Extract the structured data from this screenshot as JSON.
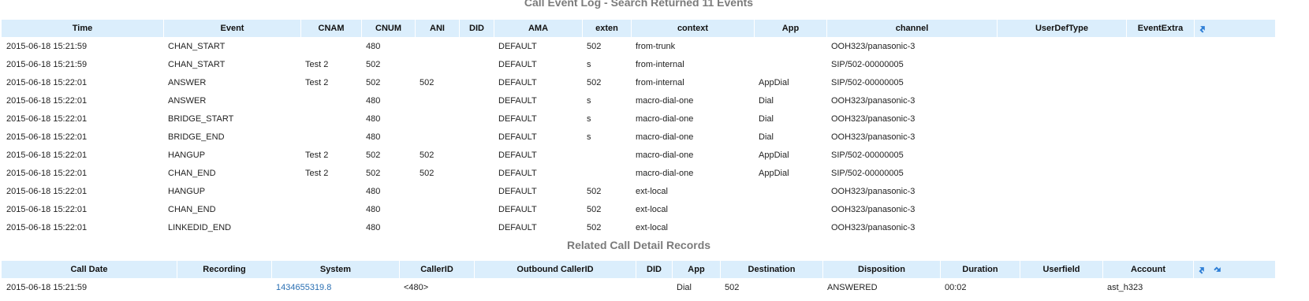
{
  "cel": {
    "title": "Call Event Log - Search Returned 11 Events",
    "columns": [
      "Time",
      "Event",
      "CNAM",
      "CNUM",
      "ANI",
      "DID",
      "AMA",
      "exten",
      "context",
      "App",
      "channel",
      "UserDefType",
      "EventExtra"
    ],
    "rows": [
      [
        "2015-06-18 15:21:59",
        "CHAN_START",
        "",
        "480",
        "",
        "",
        "DEFAULT",
        "502",
        "from-trunk",
        "",
        "OOH323/panasonic-3",
        "",
        ""
      ],
      [
        "2015-06-18 15:21:59",
        "CHAN_START",
        "Test 2",
        "502",
        "",
        "",
        "DEFAULT",
        "s",
        "from-internal",
        "",
        "SIP/502-00000005",
        "",
        ""
      ],
      [
        "2015-06-18 15:22:01",
        "ANSWER",
        "Test 2",
        "502",
        "502",
        "",
        "DEFAULT",
        "502",
        "from-internal",
        "AppDial",
        "SIP/502-00000005",
        "",
        ""
      ],
      [
        "2015-06-18 15:22:01",
        "ANSWER",
        "",
        "480",
        "",
        "",
        "DEFAULT",
        "s",
        "macro-dial-one",
        "Dial",
        "OOH323/panasonic-3",
        "",
        ""
      ],
      [
        "2015-06-18 15:22:01",
        "BRIDGE_START",
        "",
        "480",
        "",
        "",
        "DEFAULT",
        "s",
        "macro-dial-one",
        "Dial",
        "OOH323/panasonic-3",
        "",
        ""
      ],
      [
        "2015-06-18 15:22:01",
        "BRIDGE_END",
        "",
        "480",
        "",
        "",
        "DEFAULT",
        "s",
        "macro-dial-one",
        "Dial",
        "OOH323/panasonic-3",
        "",
        ""
      ],
      [
        "2015-06-18 15:22:01",
        "HANGUP",
        "Test 2",
        "502",
        "502",
        "",
        "DEFAULT",
        "",
        "macro-dial-one",
        "AppDial",
        "SIP/502-00000005",
        "",
        ""
      ],
      [
        "2015-06-18 15:22:01",
        "CHAN_END",
        "Test 2",
        "502",
        "502",
        "",
        "DEFAULT",
        "",
        "macro-dial-one",
        "AppDial",
        "SIP/502-00000005",
        "",
        ""
      ],
      [
        "2015-06-18 15:22:01",
        "HANGUP",
        "",
        "480",
        "",
        "",
        "DEFAULT",
        "502",
        "ext-local",
        "",
        "OOH323/panasonic-3",
        "",
        ""
      ],
      [
        "2015-06-18 15:22:01",
        "CHAN_END",
        "",
        "480",
        "",
        "",
        "DEFAULT",
        "502",
        "ext-local",
        "",
        "OOH323/panasonic-3",
        "",
        ""
      ],
      [
        "2015-06-18 15:22:01",
        "LINKEDID_END",
        "",
        "480",
        "",
        "",
        "DEFAULT",
        "502",
        "ext-local",
        "",
        "OOH323/panasonic-3",
        "",
        ""
      ]
    ]
  },
  "cdr": {
    "title": "Related Call Detail Records",
    "columns": [
      "Call Date",
      "Recording",
      "System",
      "CallerID",
      "Outbound CallerID",
      "DID",
      "App",
      "Destination",
      "Disposition",
      "Duration",
      "Userfield",
      "Account"
    ],
    "rows": [
      [
        "2015-06-18 15:21:59",
        "",
        "1434655319.8",
        "<480>",
        "",
        "",
        "Dial",
        "502",
        "ANSWERED",
        "00:02",
        "",
        "ast_h323"
      ]
    ],
    "link_column": 2
  },
  "icons": {
    "export": "export-arrow-icon",
    "download": "download-arrow-icon"
  },
  "colors": {
    "header_bg": "#dbeefc",
    "title_gray": "#7b7b7b",
    "link_blue": "#2a6fb3",
    "icon_blue": "#2f7fd6"
  }
}
